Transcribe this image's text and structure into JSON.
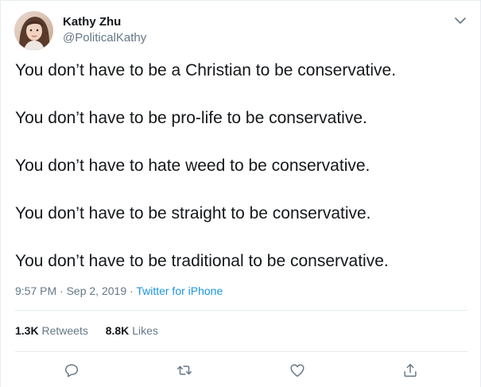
{
  "author": {
    "name": "Kathy Zhu",
    "handle": "@PoliticalKathy"
  },
  "tweet": {
    "lines": [
      "You don’t have to be a Christian to be conservative.",
      "You don’t have to be pro-life to be conservative.",
      "You don’t have to hate weed to be conservative.",
      "You don’t have to be straight to be conservative.",
      "You don’t have to be traditional to be conservative."
    ],
    "time": "9:57 PM",
    "date": "Sep 2, 2019",
    "separator": " · ",
    "source": "Twitter for iPhone"
  },
  "stats": {
    "retweets_count": "1.3K",
    "retweets_label": "Retweets",
    "likes_count": "8.8K",
    "likes_label": "Likes"
  },
  "actions": [
    "reply-icon",
    "retweet-icon",
    "like-icon",
    "share-icon"
  ],
  "colors": {
    "text": "#14171a",
    "secondary": "#657786",
    "link": "#1b95e0",
    "divider": "#e6ecf0"
  }
}
